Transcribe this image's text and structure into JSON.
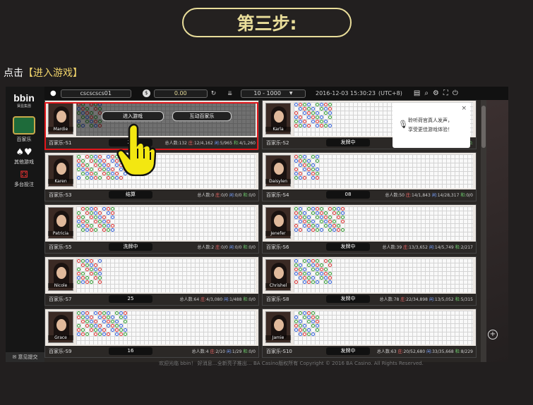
{
  "step_title": "第三步:",
  "instruction": {
    "prefix": "点击",
    "bracket_left": "【",
    "highlight": "进入游戏",
    "bracket_right": "】"
  },
  "header": {
    "username": "cscscscs01",
    "balance": "0.00",
    "limit_range": "10 - 1000",
    "datetime": "2016-12-03 15:30:23",
    "timezone": "(UTC+8)"
  },
  "sidebar": {
    "logo": "bbin",
    "logo_sub": "寶盈集團",
    "items": [
      {
        "label": "百家乐"
      },
      {
        "label": "其他游戏"
      },
      {
        "label": "多台投注"
      }
    ],
    "feedback": "意见提交"
  },
  "overlay": {
    "enter_label": "进入游戏",
    "interactive_label": "互动百家乐"
  },
  "notice": {
    "line1": "聆听荷官真人发声，",
    "line2": "享受更佳游戏体验！"
  },
  "stats_labels": {
    "total": "总人数:",
    "banker": "庄:",
    "player": "闲:",
    "tie": "和:"
  },
  "tables": [
    {
      "name": "百家乐-S1",
      "dealer": "Mardie",
      "status": "21",
      "total": "132",
      "banker": "12/4,162",
      "player": "5/965",
      "tie": "4/1,260"
    },
    {
      "name": "百家乐-S2",
      "dealer": "Karla",
      "status": "发牌中",
      "total": "",
      "banker": "",
      "player": "",
      "tie": ""
    },
    {
      "name": "百家乐-S3",
      "dealer": "Karen",
      "status": "结算",
      "total": "0",
      "banker": "0/0",
      "player": "0/0",
      "tie": "0/0"
    },
    {
      "name": "百家乐-S4",
      "dealer": "Daisylen",
      "status": "08",
      "total": "50",
      "banker": "14/1,843",
      "player": "14/28,317",
      "tie": "0/0"
    },
    {
      "name": "百家乐-S5",
      "dealer": "Patricia",
      "status": "洗牌中",
      "total": "2",
      "banker": "0/0",
      "player": "0/0",
      "tie": "0/0"
    },
    {
      "name": "百家乐-S6",
      "dealer": "Jenefer",
      "status": "发牌中",
      "total": "39",
      "banker": "13/3,652",
      "player": "14/5,749",
      "tie": "2/217"
    },
    {
      "name": "百家乐-S7",
      "dealer": "Nicole",
      "status": "25",
      "total": "64",
      "banker": "4/3,080",
      "player": "1/488",
      "tie": "0/0"
    },
    {
      "name": "百家乐-S8",
      "dealer": "Chrishel",
      "status": "发牌中",
      "total": "78",
      "banker": "22/34,898",
      "player": "13/5,052",
      "tie": "5/315"
    },
    {
      "name": "百家乐-S9",
      "dealer": "Grace",
      "status": "16",
      "total": "4",
      "banker": "2/10",
      "player": "1/29",
      "tie": "0/0"
    },
    {
      "name": "百家乐-S10",
      "dealer": "Jamie",
      "status": "发牌中",
      "total": "63",
      "banker": "20/52,680",
      "player": "33/35,668",
      "tie": "8/229"
    }
  ],
  "marquee": "欢迎光临 bbin！ 好消息…全新亮子推出… BA Casino版权所有 Copyright © 2016 BA Casino. All Rights Reserved.",
  "colors": {
    "banker": "#e03030",
    "player": "#3060e0",
    "tie": "#30a030",
    "gold": "#e9dd9a",
    "alert": "#e0161b"
  }
}
